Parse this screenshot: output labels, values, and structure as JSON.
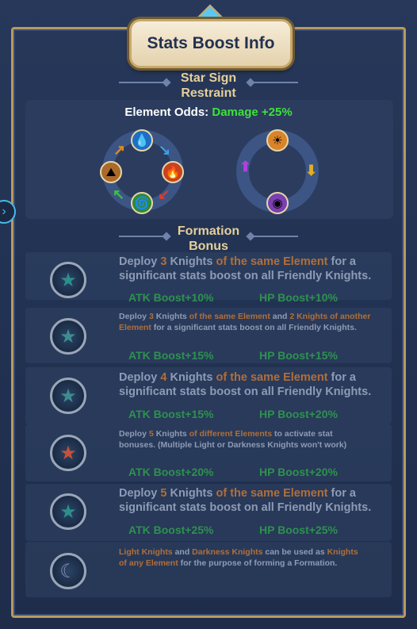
{
  "title": "Stats Boost Info",
  "star_sign": {
    "title_line1": "Star Sign",
    "title_line2": "Restraint",
    "odds_label": "Element Odds:",
    "odds_value": "Damage +25%"
  },
  "formation": {
    "title_line1": "Formation",
    "title_line2": "Bonus",
    "entries": [
      {
        "a": "Deploy ",
        "b": "3",
        "c": " Knights ",
        "d": "of the same Element",
        "e": " for a",
        "f": "significant stats boost on all Friendly Knights."
      },
      {
        "a": "Deploy ",
        "b": "3",
        "c": " Knights ",
        "d": "of the same Element",
        "e": " and ",
        "f": "2 Knights of another",
        "g": "Element",
        "h": " for a significant stats boost on all Friendly Knights."
      },
      {
        "a": "Deploy ",
        "b": "4",
        "c": " Knights ",
        "d": "of the same Element",
        "e": " for a",
        "f": "significant stats boost on all Friendly Knights."
      },
      {
        "a": "Deploy ",
        "b": "5",
        "c": " Knights ",
        "d": "of different Elements",
        "e": " to activate stat",
        "f": "bonuses. (Multiple Light or Darkness Knights won't work)"
      },
      {
        "a": "Deploy ",
        "b": "5",
        "c": " Knights ",
        "d": "of the same Element",
        "e": " for a",
        "f": "significant stats boost on all Friendly Knights."
      },
      {
        "a": "Light Knights",
        "b": " and ",
        "c": "Darkness Knights",
        "d": " can be used as ",
        "e": "Knights",
        "f": "of any Element",
        "g": " for the purpose of forming a Formation."
      }
    ],
    "boosts": [
      {
        "atk": "ATK Boost+10%",
        "hp": "HP Boost+10%"
      },
      {
        "atk": "ATK Boost+15%",
        "hp": "HP Boost+15%"
      },
      {
        "atk": "ATK Boost+15%",
        "hp": "HP Boost+20%"
      },
      {
        "atk": "ATK Boost+20%",
        "hp": "HP Boost+20%"
      },
      {
        "atk": "ATK Boost+25%",
        "hp": "HP Boost+25%"
      }
    ]
  },
  "icons": {
    "water": "water-icon",
    "fire": "fire-icon",
    "wind": "wind-icon",
    "earth": "earth-icon",
    "light": "light-icon",
    "dark": "dark-icon",
    "star": "star-icon",
    "nav": "arrow-right-icon"
  },
  "colors": {
    "accent_green": "#3ee23a",
    "gold": "#e6cf9a",
    "element_orange": "#b06f3a",
    "boost_green": "#2e9150"
  }
}
